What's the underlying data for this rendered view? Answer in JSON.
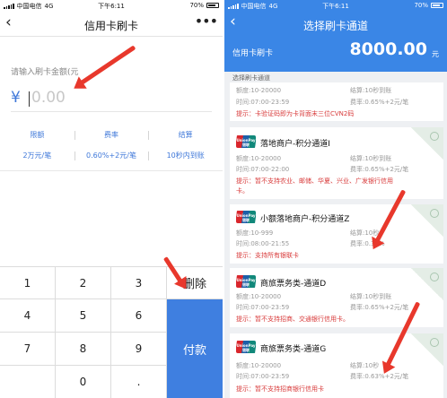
{
  "status_bar": {
    "carrier": "中国电信",
    "network": "4G",
    "time": "下午6:11",
    "battery": "70%"
  },
  "left": {
    "nav": {
      "title": "信用卡刷卡",
      "back_icon": "chevron-left-icon",
      "more_icon": "more-icon"
    },
    "amount_label": "请输入刷卡金额(元",
    "currency_symbol": "¥",
    "amount_placeholder": "0.00",
    "info_headers": [
      "限额",
      "费率",
      "结算"
    ],
    "info_values": [
      "2万元/笔",
      "0.60%+2元/笔",
      "10秒内到账"
    ],
    "keys": [
      "1",
      "2",
      "3",
      "4",
      "5",
      "6",
      "7",
      "8",
      "9",
      "0",
      "."
    ],
    "delete_label": "删除",
    "pay_label": "付款"
  },
  "right": {
    "nav": {
      "title": "选择刷卡通道",
      "back_icon": "chevron-left-icon"
    },
    "card_label": "信用卡刷卡",
    "amount": "8000.00",
    "amount_unit": "元",
    "section_label": "选择刷卡通道",
    "channels": [
      {
        "name": "",
        "quota": "额度:10-20000",
        "settle": "结算:10秒到账",
        "hours": "时间:07:00-23:59",
        "rate": "费率:0.65%+2元/笔",
        "tips": [
          "提示：卡验证码即为卡背面末三位CVN2码"
        ]
      },
      {
        "name": "落地商户-积分通道I",
        "quota": "额度:10-20000",
        "settle": "结算:10秒到账",
        "hours": "时间:07:00-22:00",
        "rate": "费率:0.65%+2元/笔",
        "tips": [
          "提示：暂不支持农业、邮储、华夏、兴业、广发银行信用",
          "卡。"
        ]
      },
      {
        "name": "小额落地商户-积分通道Z",
        "quota": "额度:10-999",
        "settle": "结算:10秒",
        "hours": "时间:08:00-21:55",
        "rate": "费率:0.38%",
        "tips": [
          "提示：支持所有银联卡"
        ]
      },
      {
        "name": "商旅票务类-通道D",
        "quota": "额度:10-20000",
        "settle": "结算:10秒到账",
        "hours": "时间:07:00-23:59",
        "rate": "费率:0.65%+2元/笔",
        "tips": [
          "提示：暂不支持招商、交通银行信用卡。"
        ]
      },
      {
        "name": "商旅票务类-通道G",
        "quota": "额度:10-20000",
        "settle": "结算:10秒",
        "hours": "时间:07:00-23:59",
        "rate": "费率:0.63%+2元/笔",
        "tips": [
          "提示：暂不支持招商银行信用卡"
        ]
      }
    ],
    "card_logo_text": "UnionPay 银联"
  },
  "colors": {
    "accent": "#3f7fe0",
    "header_blue": "#3a86e6",
    "warning_red": "#d83a3a",
    "arrow_red": "#e8382c"
  }
}
